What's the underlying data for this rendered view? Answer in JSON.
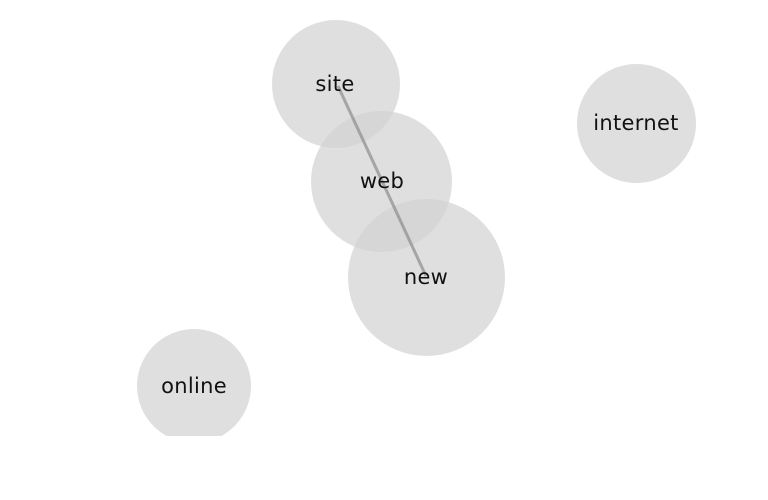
{
  "nodes": [
    {
      "id": "site",
      "label": "site"
    },
    {
      "id": "web",
      "label": "web"
    },
    {
      "id": "new",
      "label": "new"
    },
    {
      "id": "internet",
      "label": "internet"
    },
    {
      "id": "online",
      "label": "online"
    }
  ],
  "edges": [
    {
      "from": "site",
      "to": "new"
    }
  ],
  "colors": {
    "bubble": "#d2d2d2",
    "edge": "#8c8c8c",
    "label": "#111111"
  }
}
